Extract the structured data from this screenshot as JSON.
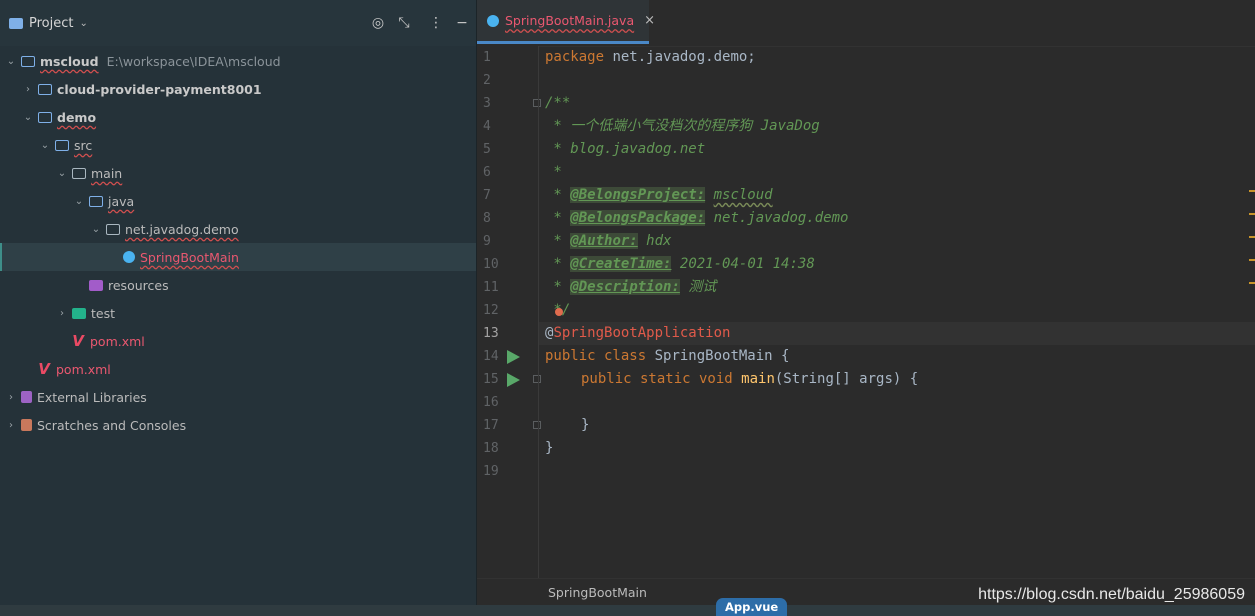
{
  "sidebar": {
    "title": "Project",
    "tree": [
      {
        "label": "mscloud",
        "path": "E:\\workspace\\IDEA\\mscloud"
      },
      {
        "label": "cloud-provider-payment8001"
      },
      {
        "label": "demo"
      },
      {
        "label": "src"
      },
      {
        "label": "main"
      },
      {
        "label": "java"
      },
      {
        "label": "net.javadog.demo"
      },
      {
        "label": "SpringBootMain"
      },
      {
        "label": "resources"
      },
      {
        "label": "test"
      },
      {
        "label": "pom.xml"
      },
      {
        "label": "pom.xml"
      },
      {
        "label": "External Libraries"
      },
      {
        "label": "Scratches and Consoles"
      }
    ]
  },
  "editor": {
    "tab": {
      "label": "SpringBootMain.java",
      "close": "×"
    },
    "lines": {
      "l1": {
        "kw": "package",
        "rest": " net.javadog.demo;"
      },
      "l3": "/**",
      "l4": " * 一个低端小气没档次的程序狗 JavaDog",
      "l5": " * blog.javadog.net",
      "l6": " *",
      "l7": {
        "tag": "@BelongsProject:",
        "val": "mscloud"
      },
      "l8": {
        "tag": "@BelongsPackage:",
        "val": "net.javadog.demo"
      },
      "l9": {
        "tag": "@Author:",
        "val": "hdx"
      },
      "l10": {
        "tag": "@CreateTime:",
        "val": "2021-04-01 14:38"
      },
      "l11": {
        "tag": "@Description:",
        "val": "测试"
      },
      "l12": " */",
      "l13": {
        "at": "@",
        "name": "SpringBootApplication"
      },
      "l14": {
        "kw": "public class",
        "rest": " SpringBootMain {"
      },
      "l15": {
        "kw": "public static void",
        "fn": "main",
        "rest": "(String[] args) {"
      },
      "l17": "}",
      "l18": "}"
    },
    "line_numbers": [
      "1",
      "2",
      "3",
      "4",
      "5",
      "6",
      "7",
      "8",
      "9",
      "10",
      "11",
      "12",
      "13",
      "14",
      "15",
      "16",
      "17",
      "18",
      "19"
    ],
    "comment_prefix": " * ",
    "breadcrumb": "SpringBootMain"
  },
  "statusbar": {
    "popup": "App.vue",
    "watermark": "https://blog.csdn.net/baidu_25986059"
  },
  "colors": {
    "keyword": "#cc7832",
    "comment": "#629755",
    "annotation": "#e05a4a",
    "sidebar_bg": "#253239",
    "editor_bg": "#2b2b2b"
  }
}
